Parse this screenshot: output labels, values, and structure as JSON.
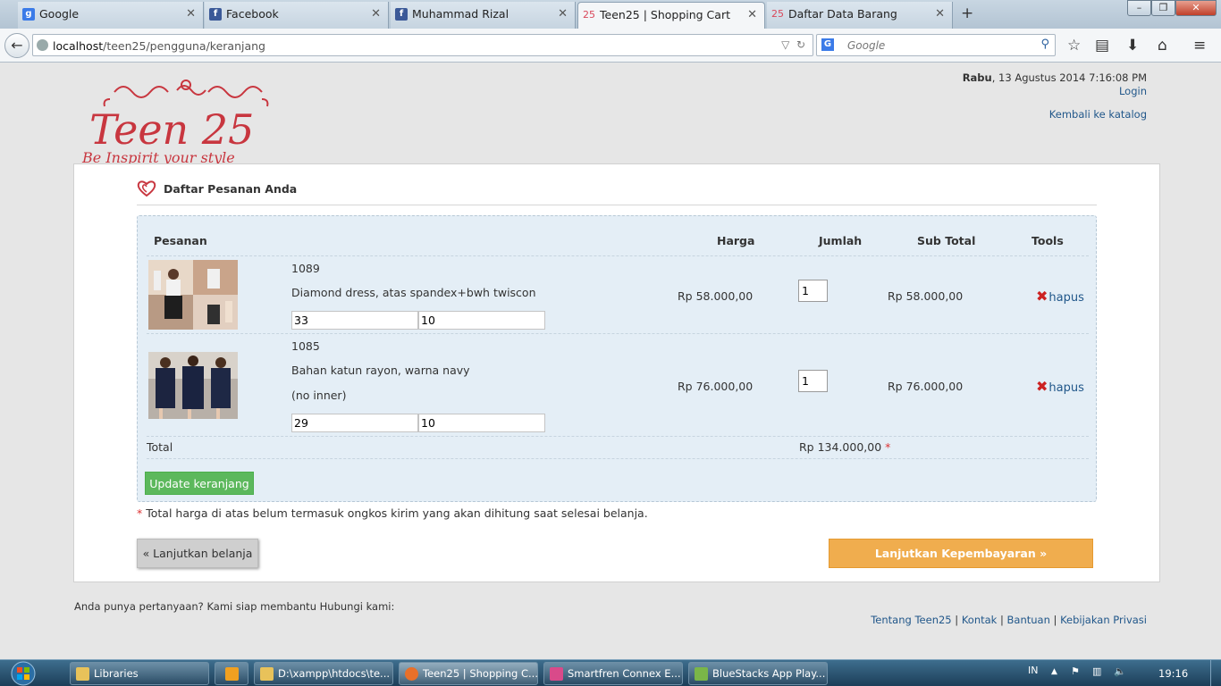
{
  "browser": {
    "tabs": [
      {
        "label": "Google",
        "icon": "google-icon",
        "color": "#3b7be8"
      },
      {
        "label": "Facebook",
        "icon": "facebook-icon",
        "color": "#3b5998"
      },
      {
        "label": "Muhammad Rizal",
        "icon": "facebook-icon",
        "color": "#3b5998"
      },
      {
        "label": "Teen25 | Shopping Cart",
        "icon": "teen25-icon",
        "color": "#d9485b",
        "active": true
      },
      {
        "label": "Daftar Data Barang",
        "icon": "teen25-icon",
        "color": "#d9485b"
      }
    ],
    "new_tab": "+",
    "url_host": "localhost",
    "url_path": "/teen25/pengguna/keranjang",
    "search_placeholder": "Google",
    "search_engine_icon": "G"
  },
  "header": {
    "day": "Rabu",
    "datetime": ", 13 Agustus 2014 7:16:08 PM",
    "login": "Login",
    "back_to_catalog": "Kembali ke katalog",
    "logo_text": "Teen 25",
    "logo_tagline": "Be Inspirit your style"
  },
  "cart": {
    "title": "Daftar Pesanan Anda",
    "columns": {
      "order": "Pesanan",
      "price": "Harga",
      "qty": "Jumlah",
      "subtotal": "Sub Total",
      "tools": "Tools"
    },
    "items": [
      {
        "code": "1089",
        "desc_lines": [
          "Diamond dress, atas spandex+bwh twiscon"
        ],
        "size_a": "33",
        "size_b": "10",
        "price": "Rp 58.000,00",
        "qty": "1",
        "subtotal": "Rp 58.000,00",
        "remove": "hapus"
      },
      {
        "code": "1085",
        "desc_lines": [
          "Bahan katun rayon, warna navy",
          "(no inner)"
        ],
        "size_a": "29",
        "size_b": "10",
        "price": "Rp 76.000,00",
        "qty": "1",
        "subtotal": "Rp 76.000,00",
        "remove": "hapus"
      }
    ],
    "total_label": "Total",
    "total_value": "Rp 134.000,00",
    "asterisk": "*",
    "update_button": "Update keranjang",
    "note": "Total harga di atas belum termasuk ongkos kirim yang akan dihitung saat selesai belanja.",
    "continue_shopping": "« Lanjutkan belanja",
    "checkout": "Lanjutkan Kepembayaran »"
  },
  "footer": {
    "question": "Anda punya pertanyaan? Kami siap membantu Hubungi kami:",
    "links": [
      "Tentang Teen25",
      "Kontak",
      "Bantuan",
      "Kebijakan Privasi"
    ],
    "separator": "|"
  },
  "taskbar": {
    "items": [
      {
        "label": "Libraries",
        "color": "#e8c25a"
      },
      {
        "label": "D:\\xampp\\htdocs\\te...",
        "color": "#e8c25a"
      },
      {
        "label": "Teen25 | Shopping C...",
        "color": "#e8702a"
      },
      {
        "label": "Smartfren Connex E...",
        "color": "#d94a8a"
      },
      {
        "label": "BlueStacks App Play...",
        "color": "#7ab648"
      }
    ],
    "lang": "IN",
    "clock": "19:16"
  },
  "colors": {
    "accent_green": "#5cb85c",
    "accent_orange": "#f0ad4e",
    "link_blue": "#21578a",
    "logo_red": "#c8363f"
  }
}
